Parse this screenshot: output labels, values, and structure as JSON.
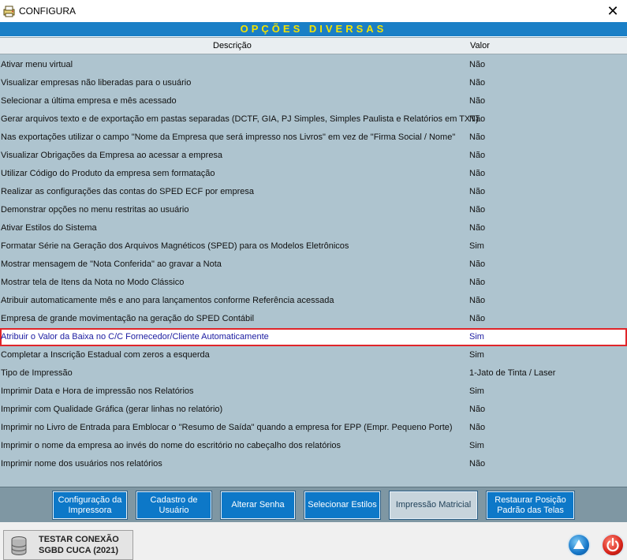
{
  "window": {
    "title": "CONFIGURA",
    "close_glyph": "✕",
    "icon": "gear-printer-icon"
  },
  "banner": {
    "title": "OPÇÕES DIVERSAS",
    "text_color": "#f4e300",
    "bg_color": "#1a7fc6"
  },
  "grid": {
    "columns": {
      "description": "Descrição",
      "value": "Valor"
    },
    "selected_row_index": 15,
    "rows": [
      {
        "description": "Ativar menu virtual",
        "value": "Não"
      },
      {
        "description": "Visualizar empresas não liberadas para o usuário",
        "value": "Não"
      },
      {
        "description": "Selecionar a última empresa e mês acessado",
        "value": "Não"
      },
      {
        "description": "Gerar arquivos texto e de exportação em pastas separadas (DCTF, GIA, PJ Simples, Simples Paulista e Relatórios em TXT)",
        "value": "Não"
      },
      {
        "description": "Nas exportações utilizar o campo \"Nome da Empresa que será impresso nos Livros\" em vez de \"Firma Social / Nome\"",
        "value": "Não"
      },
      {
        "description": "Visualizar Obrigações da Empresa ao acessar a empresa",
        "value": "Não"
      },
      {
        "description": "Utilizar Código do Produto da empresa sem formatação",
        "value": "Não"
      },
      {
        "description": "Realizar as configurações das contas do SPED ECF por empresa",
        "value": "Não"
      },
      {
        "description": "Demonstrar opções no menu restritas ao usuário",
        "value": "Não"
      },
      {
        "description": "Ativar Estilos do Sistema",
        "value": "Não"
      },
      {
        "description": "Formatar Série na Geração dos Arquivos Magnéticos (SPED) para os Modelos Eletrônicos",
        "value": "Sim"
      },
      {
        "description": "Mostrar mensagem de \"Nota Conferida\" ao gravar a Nota",
        "value": "Não"
      },
      {
        "description": "Mostrar tela de Itens da Nota no Modo Clássico",
        "value": "Não"
      },
      {
        "description": "Atribuir automaticamente mês e ano para lançamentos conforme Referência acessada",
        "value": "Não"
      },
      {
        "description": "Empresa de grande movimentação na geração do SPED Contábil",
        "value": "Não"
      },
      {
        "description": "Atribuir o Valor da Baixa no C/C Fornecedor/Cliente Automaticamente",
        "value": "Sim"
      },
      {
        "description": "Completar a Inscrição Estadual com zeros a esquerda",
        "value": "Sim"
      },
      {
        "description": "Tipo de Impressão",
        "value": "1-Jato de Tinta / Laser"
      },
      {
        "description": "Imprimir Data e Hora de impressão nos Relatórios",
        "value": "Sim"
      },
      {
        "description": "Imprimir com Qualidade Gráfica (gerar linhas no relatório)",
        "value": "Não"
      },
      {
        "description": "Imprimir no Livro de Entrada para Emblocar o \"Resumo de Saída\" quando a empresa for EPP (Empr. Pequeno Porte)",
        "value": "Não"
      },
      {
        "description": "Imprimir o nome da empresa ao invés do nome do escritório no cabeçalho dos relatórios",
        "value": "Sim"
      },
      {
        "description": "Imprimir nome dos usuários nos relatórios",
        "value": "Não"
      }
    ]
  },
  "toolbar": {
    "buttons": [
      {
        "label": "Configuração da\nImpressora"
      },
      {
        "label": "Cadastro de\nUsuário"
      },
      {
        "label": "Alterar Senha"
      },
      {
        "label": "Selecionar Estilos"
      },
      {
        "label": "Impressão Matricial"
      },
      {
        "label": "Restaurar Posição\nPadrão das Telas"
      }
    ]
  },
  "status": {
    "connection_line1": "TESTAR CONEXÃO",
    "connection_line2": "SGBD CUCA (2021)",
    "up_icon": "up-arrow-icon",
    "power_icon": "power-icon"
  }
}
